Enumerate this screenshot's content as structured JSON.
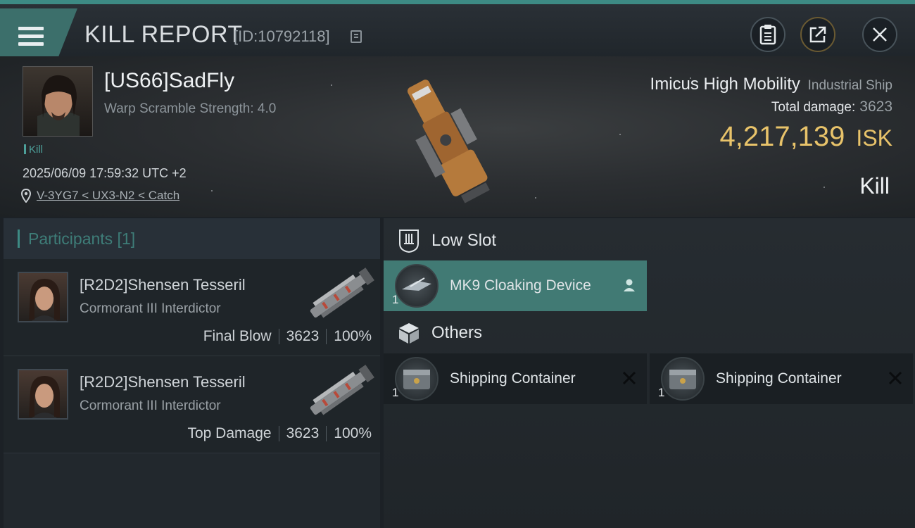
{
  "header": {
    "title": "KILL REPORT",
    "report_id": "[ID:10792118]",
    "buttons": [
      "clipboard",
      "share",
      "close"
    ]
  },
  "victim": {
    "name": "[US66]SadFly",
    "warp_scramble": "Warp Scramble Strength: 4.0",
    "tag": "Kill",
    "datetime": "2025/06/09 17:59:32 UTC +2",
    "location": "V-3YG7 < UX3-N2 < Catch",
    "ship_name": "Imicus High Mobility",
    "ship_class": "Industrial Ship",
    "total_damage_label": "Total damage:",
    "total_damage": "3623",
    "isk_value": "4,217,139",
    "isk_unit": "ISK",
    "outcome": "Kill"
  },
  "participants": {
    "title": "Participants [1]",
    "rows": [
      {
        "name": "[R2D2]Shensen Tesseril",
        "ship": "Cormorant III Interdictor",
        "role": "Final Blow",
        "damage": "3623",
        "percent": "100%"
      },
      {
        "name": "[R2D2]Shensen Tesseril",
        "ship": "Cormorant III Interdictor",
        "role": "Top Damage",
        "damage": "3623",
        "percent": "100%"
      }
    ]
  },
  "fitting": {
    "low_slot": {
      "title": "Low Slot",
      "modules": [
        {
          "qty": "1",
          "name": "MK9 Cloaking Device",
          "status": "dropped"
        }
      ]
    },
    "others": {
      "title": "Others",
      "modules": [
        {
          "qty": "1",
          "name": "Shipping Container",
          "status": "destroyed"
        },
        {
          "qty": "1",
          "name": "Shipping Container",
          "status": "destroyed"
        }
      ]
    }
  },
  "colors": {
    "accent": "#3d8a84",
    "isk": "#e8c36a",
    "highlight": "#417a74"
  }
}
